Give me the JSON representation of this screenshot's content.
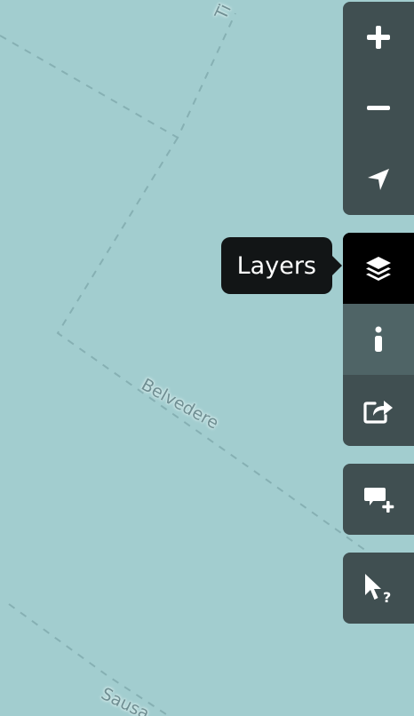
{
  "map": {
    "background": "#a2cdcf",
    "labels": {
      "top": "Ti",
      "belvedere": "Belvedere",
      "bottom": "Sausa"
    }
  },
  "controls": {
    "zoom_in": {
      "icon": "plus-icon",
      "label": "Zoom in"
    },
    "zoom_out": {
      "icon": "minus-icon",
      "label": "Zoom out"
    },
    "locate": {
      "icon": "location-arrow-icon",
      "label": "Locate"
    },
    "layers": {
      "icon": "layers-icon",
      "tooltip": "Layers",
      "state": "active"
    },
    "info": {
      "icon": "info-icon"
    },
    "share": {
      "icon": "share-icon"
    },
    "add_note": {
      "icon": "comment-plus-icon"
    },
    "query": {
      "icon": "pointer-question-icon"
    }
  },
  "colors": {
    "control_bg": "#404f51",
    "control_active": "#000000",
    "control_hover": "#4f6466",
    "tooltip_bg": "#121516"
  }
}
